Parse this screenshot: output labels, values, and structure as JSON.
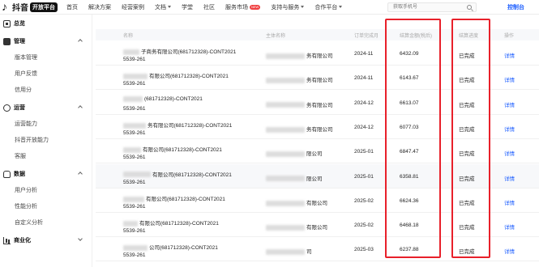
{
  "topbar": {
    "logo_text": "抖音",
    "logo_badge": "开放平台",
    "nav": [
      {
        "label": "首页",
        "caret": false
      },
      {
        "label": "解决方案",
        "caret": false
      },
      {
        "label": "经营案例",
        "caret": false
      },
      {
        "label": "文档",
        "caret": true
      },
      {
        "label": "学堂",
        "caret": false
      },
      {
        "label": "社区",
        "caret": false
      },
      {
        "label": "服务市场",
        "caret": false,
        "badge": "NEW"
      },
      {
        "label": "支持与服务",
        "caret": true
      },
      {
        "label": "合作平台",
        "caret": true
      }
    ],
    "search_placeholder": "获取手机号",
    "console_label": "控制台"
  },
  "sidebar": {
    "sections": [
      {
        "label": "总览",
        "icon": "grid-icon",
        "items": []
      },
      {
        "label": "管理",
        "icon": "box-icon",
        "items": [
          "版本管理",
          "用户反馈",
          "信用分"
        ]
      },
      {
        "label": "运营",
        "icon": "wrench-icon",
        "items": [
          "运营能力",
          "抖音开放能力",
          "客服"
        ]
      },
      {
        "label": "数据",
        "icon": "database-icon",
        "items": [
          "用户分析",
          "性能分析",
          "自定义分析"
        ]
      },
      {
        "label": "商业化",
        "icon": "chart-icon",
        "items": []
      }
    ]
  },
  "table": {
    "headers": [
      "名称",
      "主体名称",
      "订单完成月",
      "结算金额(税后)",
      "结算进度",
      "操作"
    ],
    "rows": [
      {
        "name_line1": "子商务有限公司(681712328)-CONT2021",
        "name_line2": "5539-261",
        "entity": "务有限公司",
        "month": "2024-11",
        "amount": "6432.09",
        "status": "已完成",
        "action": "详情"
      },
      {
        "name_line1": "有限公司(681712328)-CONT2021",
        "name_line2": "5539-261",
        "entity": "务有限公司",
        "month": "2024-11",
        "amount": "6143.67",
        "status": "已完成",
        "action": "详情"
      },
      {
        "name_line1": "(681712328)-CONT2021",
        "name_line2": "5539-261",
        "entity": "务有限公司",
        "month": "2024-12",
        "amount": "6613.07",
        "status": "已完成",
        "action": "详情"
      },
      {
        "name_line1": "务有限公司(681712328)-CONT2021",
        "name_line2": "5539-261",
        "entity": "务有限公司",
        "month": "2024-12",
        "amount": "6077.03",
        "status": "已完成",
        "action": "详情"
      },
      {
        "name_line1": "有限公司(681712328)-CONT2021",
        "name_line2": "5539-261",
        "entity": "限公司",
        "month": "2025-01",
        "amount": "6847.47",
        "status": "已完成",
        "action": "详情"
      },
      {
        "name_line1": "有限公司(681712328)-CONT2021",
        "name_line2": "5539-261",
        "entity": "限公司",
        "month": "2025-01",
        "amount": "6358.81",
        "status": "已完成",
        "action": "详情"
      },
      {
        "name_line1": "有限公司(681712328)-CONT2021",
        "name_line2": "5539-261",
        "entity": "有限公司",
        "month": "2025-02",
        "amount": "6624.36",
        "status": "已完成",
        "action": "详情"
      },
      {
        "name_line1": "有限公司(681712328)-CONT2021",
        "name_line2": "5539-261",
        "entity": "有限公司",
        "month": "2025-02",
        "amount": "6468.18",
        "status": "已完成",
        "action": "详情"
      },
      {
        "name_line1": "公司(681712328)-CONT2021",
        "name_line2": "5539-261",
        "entity": "司",
        "month": "2025-03",
        "amount": "6237.88",
        "status": "已完成",
        "action": "详情"
      }
    ]
  },
  "colors": {
    "accent": "#1a5cff",
    "highlight": "#e8202a"
  }
}
